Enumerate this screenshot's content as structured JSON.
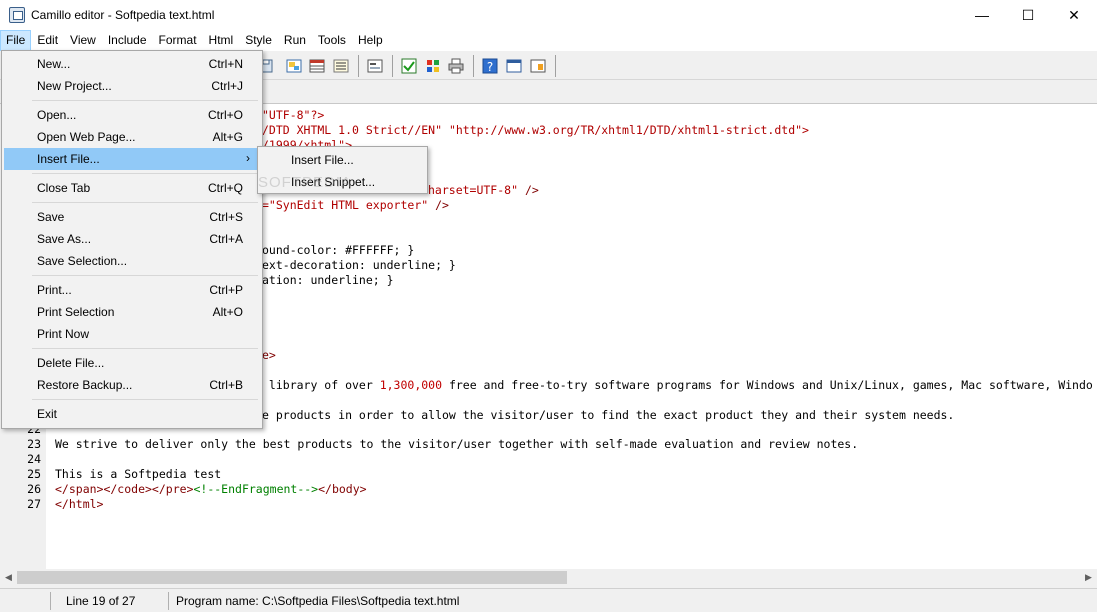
{
  "window": {
    "title": "Camillo editor - Softpedia text.html",
    "minimize": "—",
    "maximize": "☐",
    "close": "✕"
  },
  "menubar": [
    "File",
    "Edit",
    "View",
    "Include",
    "Format",
    "Html",
    "Style",
    "Run",
    "Tools",
    "Help"
  ],
  "file_menu": [
    {
      "label": "New...",
      "shortcut": "Ctrl+N"
    },
    {
      "label": "New Project...",
      "shortcut": "Ctrl+J"
    },
    {
      "label": "Open...",
      "shortcut": "Ctrl+O"
    },
    {
      "label": "Open Web Page...",
      "shortcut": "Alt+G"
    },
    {
      "label": "Insert File...",
      "shortcut": "",
      "submenu_arrow": "›"
    },
    {
      "label": "Close Tab",
      "shortcut": "Ctrl+Q"
    },
    {
      "label": "Save",
      "shortcut": "Ctrl+S"
    },
    {
      "label": "Save As...",
      "shortcut": "Ctrl+A"
    },
    {
      "label": "Save Selection...",
      "shortcut": ""
    },
    {
      "label": "Print...",
      "shortcut": "Ctrl+P"
    },
    {
      "label": "Print Selection",
      "shortcut": "Alt+O"
    },
    {
      "label": "Print Now",
      "shortcut": ""
    },
    {
      "label": "Delete File...",
      "shortcut": ""
    },
    {
      "label": "Restore Backup...",
      "shortcut": "Ctrl+B"
    },
    {
      "label": "Exit",
      "shortcut": ""
    }
  ],
  "insert_submenu": [
    "Insert File...",
    "Insert Snippet..."
  ],
  "editor": {
    "fragments": {
      "l1": "\"UTF-8\"?>",
      "l2a": "/DTD XHTML 1.0 Strict//EN\" ",
      "l2b": "\"http://www.w3.org/TR/xhtml1/DTD/xhtml1-strict.dtd\">",
      "l3": "/1999/xhtml\">",
      "l6a": "harset=UTF-8\"",
      "l6b": " />",
      "l7a": "=\"SynEdit HTML exporter\"",
      "l7b": " />",
      "l10": "ound-color: #FFFFFF; }",
      "l11": "ext-decoration: underline; }",
      "l12": "ation: underline; }",
      "l17": "e>",
      "l19a": " library of over ",
      "l19b": "1,300,000",
      "l19c": " free and free-to-try software programs for Windows and Unix/Linux, games, Mac software, Windo",
      "l21": "e products in order to allow the visitor/user to find the exact product they and their system needs.",
      "l23": "We strive to deliver only the best products to the visitor/user together with self-made evaluation and review notes.",
      "l25": "This is a Softpedia test",
      "l26a": "</span></code></pre>",
      "l26b": "<!--EndFragment-->",
      "l26c": "</body>",
      "l27": "</html>"
    },
    "line_numbers": [
      "22",
      "23",
      "24",
      "25",
      "26",
      "27"
    ]
  },
  "watermark": "SOFTPEDIA",
  "status": {
    "line": "Line 19 of 27",
    "program": "Program name: C:\\Softpedia Files\\Softpedia text.html"
  }
}
